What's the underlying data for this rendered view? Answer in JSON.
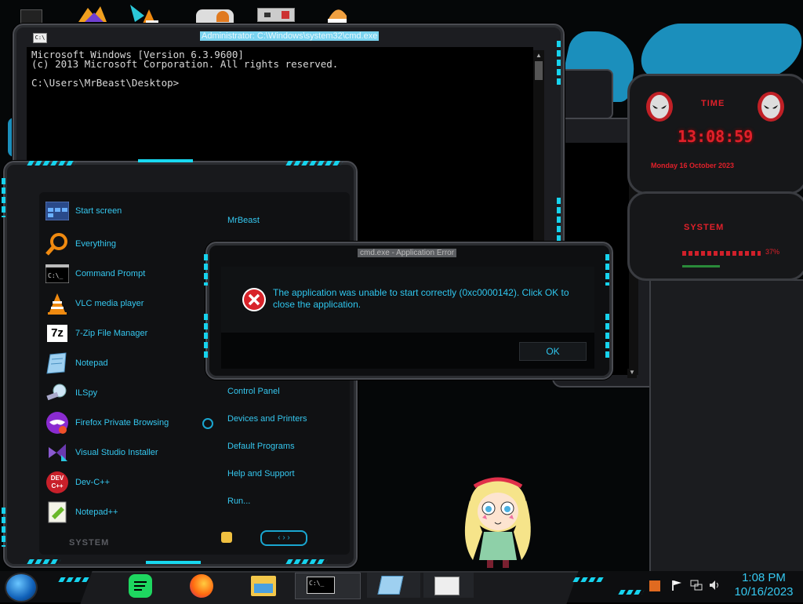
{
  "cmd": {
    "title": "Administrator: C:\\Windows\\system32\\cmd.exe",
    "icon_label": "C:\\",
    "lines": [
      "Microsoft Windows [Version 6.3.9600]",
      "(c) 2013 Microsoft Corporation. All rights reserved.",
      "",
      "C:\\Users\\MrBeast\\Desktop>"
    ]
  },
  "start_menu": {
    "items": [
      {
        "label": "Start screen",
        "icon": "start-screen-icon"
      },
      {
        "label": "Everything",
        "icon": "magnifier-icon"
      },
      {
        "label": "Command Prompt",
        "icon": "command-prompt-icon"
      },
      {
        "label": "VLC media player",
        "icon": "vlc-cone-icon"
      },
      {
        "label": "7-Zip File Manager",
        "icon": "7zip-icon"
      },
      {
        "label": "Notepad",
        "icon": "notepad-icon"
      },
      {
        "label": "ILSpy",
        "icon": "ilspy-icon"
      },
      {
        "label": "Firefox Private Browsing",
        "icon": "firefox-private-icon"
      },
      {
        "label": "Visual Studio Installer",
        "icon": "visual-studio-icon"
      },
      {
        "label": "Dev-C++",
        "icon": "devcpp-icon"
      },
      {
        "label": "Notepad++",
        "icon": "notepadpp-icon"
      }
    ],
    "right_items": {
      "user": "MrBeast",
      "control_panel": "Control Panel",
      "devices": "Devices and Printers",
      "default_programs": "Default Programs",
      "help": "Help and Support",
      "run": "Run..."
    },
    "system_label": "SYSTEM",
    "seven_zip_glyph": "7z",
    "dev_glyph": "DEV\nC++"
  },
  "dialog": {
    "title": "cmd.exe - Application Error",
    "message": "The application was unable to start correctly (0xc0000142). Click OK to close the application.",
    "ok_label": "OK"
  },
  "widget": {
    "time_label": "TIME",
    "time_value": "13:08:59",
    "date_value": "Monday 16 October 2023",
    "system_label": "SYSTEM",
    "cpu_value": "37%"
  },
  "taskbar": {
    "time": "1:08 PM",
    "date": "10/16/2023",
    "cmd_icon_label": "C:\\_"
  },
  "colors": {
    "accent": "#2fc6ee",
    "frame": "#1c1d21",
    "error_red": "#d8232a",
    "widget_red": "#e0202a"
  }
}
